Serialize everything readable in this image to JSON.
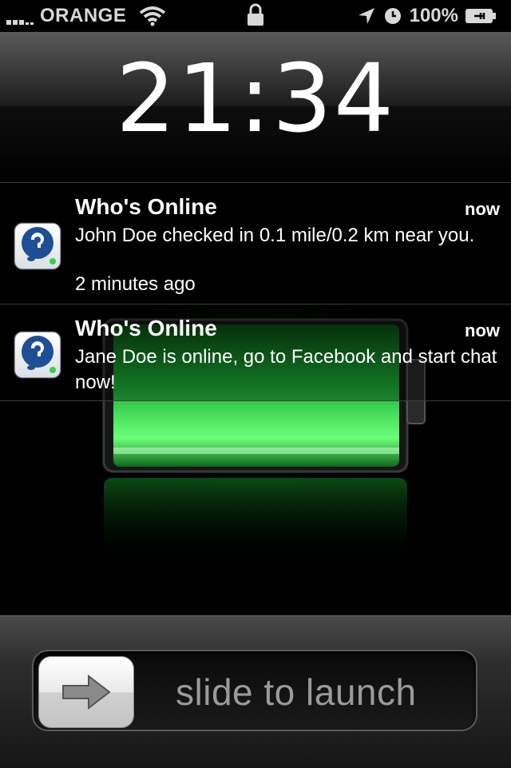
{
  "status_bar": {
    "carrier": "ORANGE",
    "battery_percent": "100%",
    "signal_bars": 5
  },
  "lock_screen": {
    "time": "21:34"
  },
  "notifications": [
    {
      "app": "Who's Online",
      "time": "now",
      "message": "John Doe checked in 0.1 mile/0.2 km near you.",
      "sub": "2 minutes ago"
    },
    {
      "app": "Who's Online",
      "time": "now",
      "message": "Jane Doe is online, go to Facebook and start chat now!"
    }
  ],
  "slider": {
    "label": "slide to launch"
  },
  "colors": {
    "battery_green": "#22d43a",
    "background": "#000000"
  },
  "icons": [
    "wifi-icon",
    "lock-icon",
    "location-arrow-icon",
    "clock-icon",
    "battery-icon",
    "arrow-right-icon",
    "app-icon"
  ]
}
